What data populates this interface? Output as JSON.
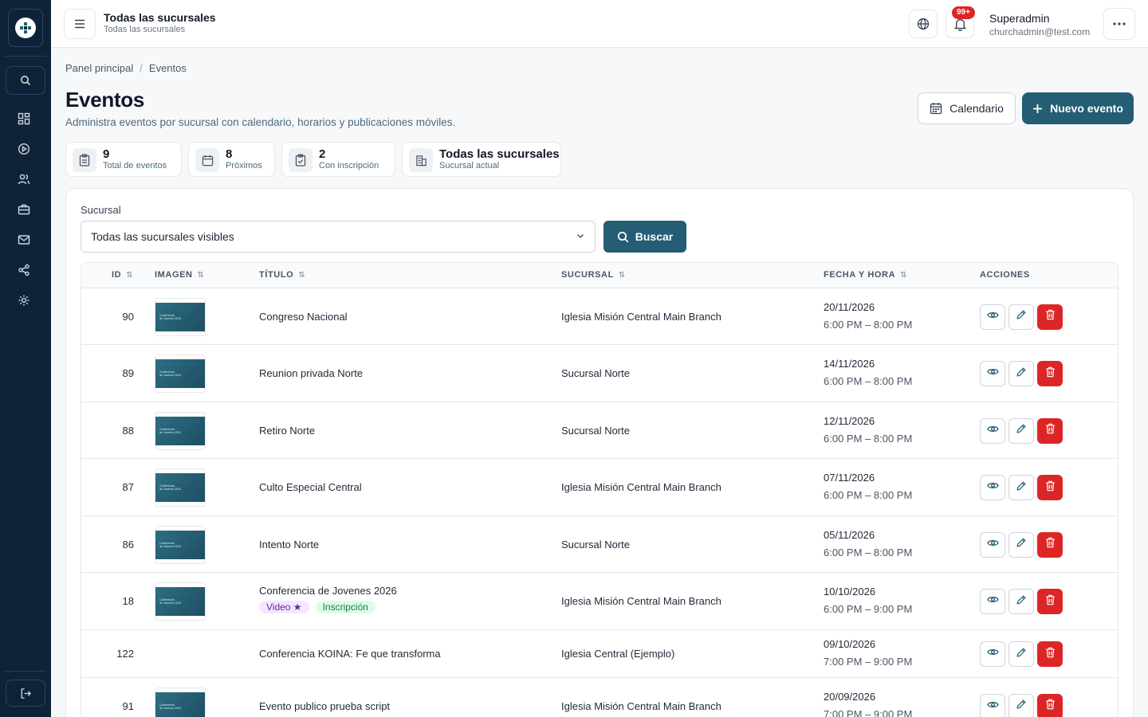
{
  "topbar": {
    "branch_title": "Todas las sucursales",
    "branch_subtitle": "Todas las sucursales",
    "notifications_badge": "99+",
    "user_name": "Superadmin",
    "user_email": "churchadmin@test.com"
  },
  "breadcrumb": {
    "home": "Panel principal",
    "current": "Eventos",
    "separator": "/"
  },
  "page": {
    "title": "Eventos",
    "subtitle": "Administra eventos por sucursal con calendario, horarios y publicaciones móviles.",
    "calendar_button": "Calendario",
    "new_button": "Nuevo evento"
  },
  "stats": [
    {
      "value": "9",
      "label": "Total de eventos",
      "icon": "clipboard-icon"
    },
    {
      "value": "8",
      "label": "Próximos",
      "icon": "calendar-icon"
    },
    {
      "value": "2",
      "label": "Con inscripción",
      "icon": "clipboard-check-icon"
    },
    {
      "value": "Todas las sucursales",
      "label": "Sucursal actual",
      "icon": "building-icon"
    }
  ],
  "filter": {
    "label": "Sucursal",
    "selected": "Todas las sucursales visibles",
    "search_button": "Buscar"
  },
  "table": {
    "headers": {
      "id": "ID",
      "image": "IMAGEN",
      "title": "TÍTULO",
      "branch": "SUCURSAL",
      "datetime": "FECHA Y HORA",
      "actions": "ACCIONES"
    },
    "rows": [
      {
        "id": "90",
        "title": "Congreso Nacional",
        "branch": "Iglesia Misión Central Main Branch",
        "date": "20/11/2026",
        "time": "6:00 PM – 8:00 PM"
      },
      {
        "id": "89",
        "title": "Reunion privada Norte",
        "branch": "Sucursal Norte",
        "date": "14/11/2026",
        "time": "6:00 PM – 8:00 PM"
      },
      {
        "id": "88",
        "title": "Retiro Norte",
        "branch": "Sucursal Norte",
        "date": "12/11/2026",
        "time": "6:00 PM – 8:00 PM"
      },
      {
        "id": "87",
        "title": "Culto Especial Central",
        "branch": "Iglesia Misión Central Main Branch",
        "date": "07/11/2026",
        "time": "6:00 PM – 8:00 PM"
      },
      {
        "id": "86",
        "title": "Intento Norte",
        "branch": "Sucursal Norte",
        "date": "05/11/2026",
        "time": "6:00 PM – 8:00 PM"
      },
      {
        "id": "18",
        "title": "Conferencia de Jovenes 2026",
        "branch": "Iglesia Misión Central Main Branch",
        "date": "10/10/2026",
        "time": "6:00 PM – 9:00 PM",
        "tag_video": "Video ★",
        "tag_registration": "Inscripción"
      },
      {
        "id": "122",
        "title": "Conferencia KOINA: Fe que transforma",
        "branch": "Iglesia Central (Ejemplo)",
        "date": "09/10/2026",
        "time": "7:00 PM – 9:00 PM"
      },
      {
        "id": "91",
        "title": "Evento publico prueba script",
        "branch": "Iglesia Misión Central Main Branch",
        "date": "20/09/2026",
        "time": "7:00 PM – 9:00 PM"
      }
    ]
  },
  "colors": {
    "sidebar": "#0f2338",
    "primary": "#245d74",
    "danger": "#dc2626"
  }
}
